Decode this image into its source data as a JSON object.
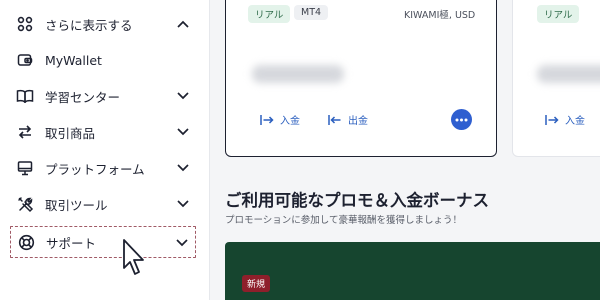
{
  "sidebar": {
    "items": [
      {
        "label": "さらに表示する",
        "icon": "grid-icon"
      },
      {
        "label": "MyWallet",
        "icon": "wallet-icon"
      },
      {
        "label": "学習センター",
        "icon": "book-icon"
      },
      {
        "label": "取引商品",
        "icon": "swap-arrows-icon"
      },
      {
        "label": "プラットフォーム",
        "icon": "monitor-icon"
      },
      {
        "label": "取引ツール",
        "icon": "tools-icon"
      },
      {
        "label": "サポート",
        "icon": "lifebuoy-icon"
      }
    ]
  },
  "account_card": {
    "tag_type": "リアル",
    "tag_platform": "MT4",
    "account_info": "KIWAMI極, USD",
    "deposit_label": "入金",
    "withdraw_label": "出金"
  },
  "second_card": {
    "tag_type": "リアル",
    "deposit_label": "入金"
  },
  "promo": {
    "title": "ご利用可能なプロモ＆入金ボーナス",
    "subtitle": "プロモーションに参加して豪華報酬を獲得しましょう！",
    "badge": "新規"
  },
  "colors": {
    "accent_blue": "#2f5fd0",
    "banner_green": "#16452f",
    "badge_red": "#8e1f2b"
  }
}
